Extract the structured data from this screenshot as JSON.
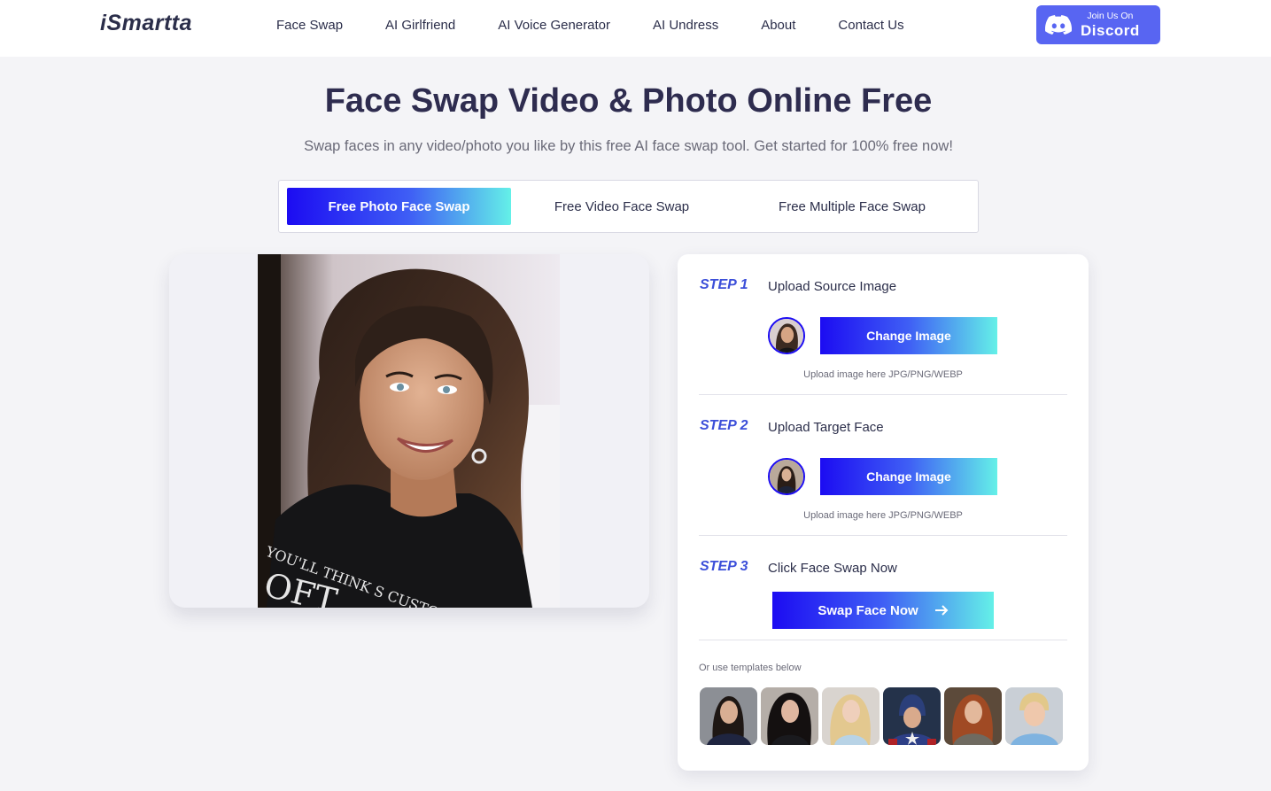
{
  "header": {
    "logo": "iSmartta",
    "nav": [
      "Face Swap",
      "AI Girlfriend",
      "AI Voice Generator",
      "AI Undress",
      "About",
      "Contact Us"
    ],
    "discord": {
      "small": "Join Us On",
      "big": "Discord",
      "color": "#5865f2"
    }
  },
  "hero": {
    "title": "Face Swap Video & Photo Online Free",
    "subtitle": "Swap faces in any video/photo you like by this free AI face swap tool. Get started for 100% free now!"
  },
  "tabs": [
    {
      "label": "Free Photo Face Swap",
      "active": true
    },
    {
      "label": "Free Video Face Swap",
      "active": false
    },
    {
      "label": "Free Multiple Face Swap",
      "active": false
    }
  ],
  "steps": [
    {
      "label": "STEP 1",
      "title": "Upload Source Image",
      "button": "Change Image",
      "hint": "Upload image here JPG/PNG/WEBP"
    },
    {
      "label": "STEP 2",
      "title": "Upload Target Face",
      "button": "Change Image",
      "hint": "Upload image here JPG/PNG/WEBP"
    },
    {
      "label": "STEP 3",
      "title": "Click Face Swap Now",
      "button": "Swap Face Now"
    }
  ],
  "templates": {
    "label": "Or use templates below",
    "items": [
      "template-dark-hair-woman",
      "template-curly-hair-woman",
      "template-blonde-woman",
      "template-captain-hero",
      "template-red-hair-warrior",
      "template-blonde-man"
    ]
  },
  "colors": {
    "accent": "#1c0cf2",
    "gradient_end": "#64f0e8",
    "step_label": "#3c4fd9"
  }
}
